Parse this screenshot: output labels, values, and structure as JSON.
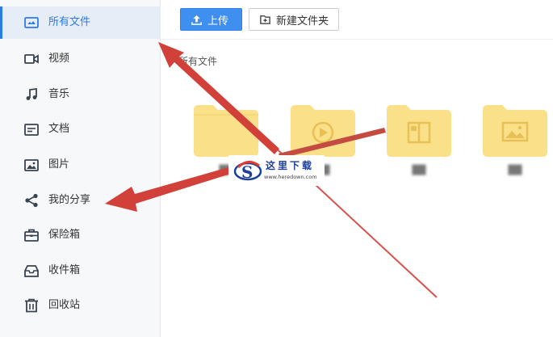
{
  "sidebar": {
    "items": [
      {
        "label": "所有文件",
        "icon": "all-files-icon",
        "active": true
      },
      {
        "label": "视频",
        "icon": "video-icon"
      },
      {
        "label": "音乐",
        "icon": "music-icon"
      },
      {
        "label": "文档",
        "icon": "document-icon"
      },
      {
        "label": "图片",
        "icon": "image-icon"
      },
      {
        "label": "我的分享",
        "icon": "share-icon"
      },
      {
        "label": "保险箱",
        "icon": "safe-box-icon"
      },
      {
        "label": "收件箱",
        "icon": "inbox-icon"
      },
      {
        "label": "回收站",
        "icon": "recycle-bin-icon"
      }
    ]
  },
  "toolbar": {
    "upload_label": "上传",
    "new_folder_label": "新建文件夹"
  },
  "breadcrumb": {
    "current": "所有文件"
  },
  "folders": [
    {
      "icon": "folder-icon"
    },
    {
      "icon": "video-folder-icon"
    },
    {
      "icon": "document-folder-icon"
    },
    {
      "icon": "image-folder-icon"
    }
  ],
  "watermark": {
    "text": "这里下载",
    "url": "www.heredown.com"
  },
  "colors": {
    "accent": "#2b7be6",
    "folder": "#fbe08a",
    "arrow": "#d2403a",
    "sidebar_bg": "#f7f8fa"
  }
}
